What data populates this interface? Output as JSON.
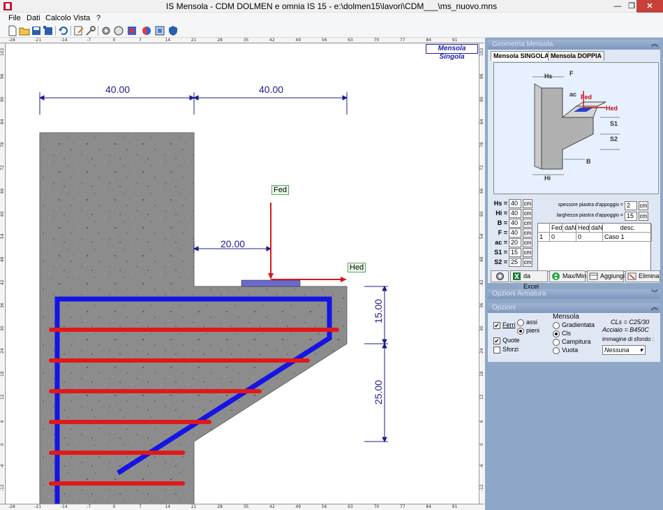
{
  "window": {
    "title": "IS Mensola - CDM DOLMEN e omnia IS 15 - e:\\dolmen15\\lavori\\CDM___\\ms_nuovo.mns",
    "minimize": "—",
    "maximize": "❐",
    "close": "✕"
  },
  "menu": [
    "File",
    "Dati",
    "Calcolo",
    "Vista",
    "?"
  ],
  "toolbar": {
    "icons": [
      "new-file",
      "open-folder",
      "save",
      "save-all",
      "undo",
      "edit",
      "tools",
      "settings",
      "calc",
      "refresh",
      "color",
      "layers",
      "shield"
    ]
  },
  "rulers": {
    "top": [
      "-28",
      "-21",
      "-14",
      "-7",
      "0",
      "7",
      "14",
      "21",
      "28",
      "35",
      "42",
      "49",
      "56",
      "63",
      "70",
      "77",
      "84",
      "91"
    ],
    "left": [
      "102",
      "96",
      "90",
      "84",
      "78",
      "72",
      "66",
      "60",
      "54",
      "48",
      "42",
      "36",
      "30",
      "24",
      "18",
      "12",
      "6",
      "0",
      "-6",
      "-12"
    ]
  },
  "canvas": {
    "mode_badge": "Mensola Singola",
    "dims": {
      "top_left": "40.00",
      "top_right": "40.00",
      "load_offset": "20.00",
      "right_upper": "15.00",
      "right_lower": "25.00"
    },
    "labels": {
      "fed": "Fed",
      "hed": "Hed"
    },
    "colors": {
      "concrete": "#8a8a8a",
      "stirrup": "#1414e6",
      "bar": "#e21818",
      "dimension": "#1c1c8c",
      "plate": "#6a6acc"
    }
  },
  "geometry_panel": {
    "header": "Geometria Mensola",
    "tabs": [
      "Mensola SINGOLA",
      "Mensola DOPPIA"
    ],
    "preview_labels": {
      "hs": "Hs",
      "f": "F",
      "ac": "ac",
      "fed": "Fed",
      "hed": "Hed",
      "s1": "S1",
      "s2": "S2",
      "b": "B",
      "hi": "Hi"
    },
    "params": [
      {
        "label": "Hs =",
        "value": "40",
        "unit": "cm"
      },
      {
        "label": "Hi =",
        "value": "40",
        "unit": "cm"
      },
      {
        "label": "B =",
        "value": "40",
        "unit": "cm"
      },
      {
        "label": "F =",
        "value": "40",
        "unit": "cm"
      },
      {
        "label": "ac =",
        "value": "20",
        "unit": "cm"
      },
      {
        "label": "S1 =",
        "value": "15",
        "unit": "cm"
      },
      {
        "label": "S2 =",
        "value": "25",
        "unit": "cm"
      }
    ],
    "plate_thickness": {
      "label": "spessore piastra d'appoggio =",
      "value": "2",
      "unit": "cm"
    },
    "plate_width": {
      "label": "larghezza piastra d'appoggio =",
      "value": "15",
      "unit": "cm"
    },
    "table": {
      "headers": [
        "Fed",
        "daN",
        "Hed",
        "daN",
        "desc."
      ],
      "rows": [
        [
          "1",
          "0",
          "0",
          "Caso 1"
        ]
      ]
    },
    "buttons": {
      "excel": "da Excel",
      "maxmin": "Max/Min",
      "add": "Aggiungi",
      "delete": "Elimina"
    }
  },
  "options_panel": {
    "header_outer": "Opzioni Armatura",
    "header_inner": "Opzioni",
    "ferri": "Ferri",
    "assi": "assi",
    "pieni": "pieni",
    "quote": "Quote",
    "sforzi": "Sforzi",
    "mensola_title": "Mensola",
    "gradientata": "Gradientata",
    "cls": "Cls",
    "campitura": "Campitura",
    "vuota": "Vuota",
    "cls_class": "CLs = C25/30",
    "steel_class": "Acciaio = B450C",
    "bg_label": "immagine di sfondo :",
    "bg_value": "Nessuna"
  }
}
